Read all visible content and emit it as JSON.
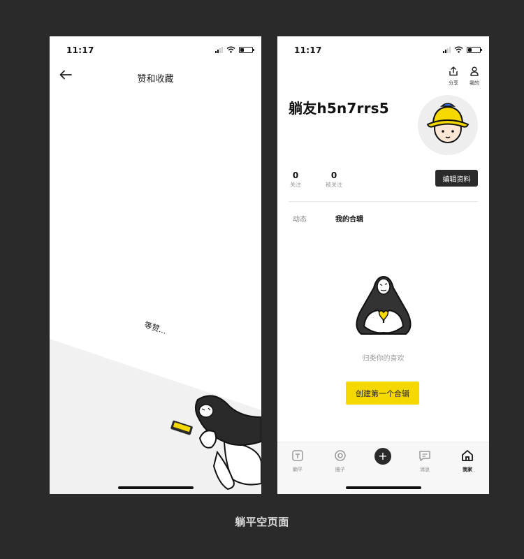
{
  "left_screen": {
    "status_time": "11:17",
    "title": "赞和收藏",
    "waiting_text": "等赞..."
  },
  "right_screen": {
    "status_time": "11:17",
    "toolbar": {
      "share_label": "分享",
      "mine_label": "我的"
    },
    "profile": {
      "username": "躺友h5n7rrs5",
      "following_count": "0",
      "following_label": "关注",
      "followers_count": "0",
      "followers_label": "被关注",
      "edit_label": "编辑资料"
    },
    "tabs": [
      "动态",
      "我的合辑"
    ],
    "active_tab": "我的合辑",
    "empty_state": {
      "text": "归类你的喜欢",
      "button_label": "创建第一个合辑"
    },
    "tabbar": [
      "躺平",
      "圈子",
      "",
      "消息",
      "我家"
    ],
    "tabbar_active": "我家"
  },
  "caption": "躺平空页面",
  "colors": {
    "background": "#2a2a2a",
    "accent_yellow": "#f5d800",
    "dark_button": "#2a2a2a"
  }
}
